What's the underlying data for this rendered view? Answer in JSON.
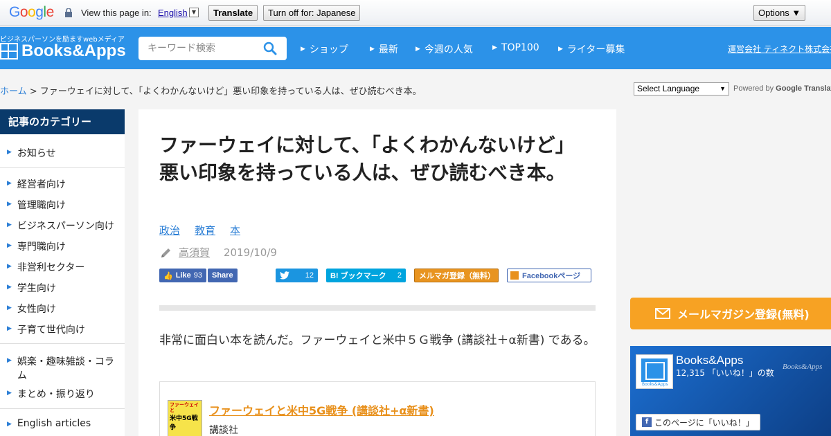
{
  "translate_bar": {
    "logo_letters": [
      "G",
      "o",
      "o",
      "g",
      "l",
      "e"
    ],
    "view_label": "View this page in:",
    "language": "English",
    "translate_button": "Translate",
    "turn_off_button": "Turn off for: Japanese",
    "options_button": "Options ▼"
  },
  "header": {
    "tagline": "ビジネスパーソンを励ますwebメディア",
    "logo_text": "Books&Apps",
    "search_placeholder": "キーワード検索",
    "nav": [
      "ショップ",
      "最新",
      "今週の人気",
      "TOP100",
      "ライター募集"
    ],
    "corp_link": "運営会社 ティネクト株式会社"
  },
  "breadcrumb": {
    "home": "ホーム",
    "separator": " > ",
    "current": "ファーウェイに対して、「よくわかんないけど」悪い印象を持っている人は、ぜひ読むべき本。"
  },
  "language_widget": {
    "select_label": "Select Language",
    "powered_by": "Powered by",
    "google": "Google",
    "translate": "Translate"
  },
  "sidebar": {
    "title": "記事のカテゴリー",
    "items": [
      "お知らせ",
      "経営者向け",
      "管理職向け",
      "ビジネスパーソン向け",
      "専門職向け",
      "非営利セクター",
      "学生向け",
      "女性向け",
      "子育て世代向け",
      "娯楽・趣味雑談・コラム",
      "まとめ・振り返り",
      "English articles"
    ]
  },
  "article": {
    "title": "ファーウェイに対して、「よくわかんないけど」悪い印象を持っている人は、ぜひ読むべき本。",
    "tags": [
      "政治",
      "教育",
      "本"
    ],
    "author": "高須賀",
    "date": "2019/10/9",
    "share": {
      "like_label": "Like",
      "like_count": "93",
      "share_label": "Share",
      "tweet_count": "12",
      "hatena_label": "B! ブックマーク",
      "hatena_count": "2",
      "mail_label": "メルマガ登録（無料）",
      "fbpage_label": "Facebookページ"
    },
    "body": "非常に面白い本を読んだ。ファーウェイと米中５Ｇ戦争 (講談社＋α新書) である。",
    "book": {
      "cover_top": "ファーウェイと",
      "cover_main": "米中5G戦争",
      "title": "ファーウェイと米中5G戦争 (講談社+α新書)",
      "publisher": "講談社"
    }
  },
  "right": {
    "mailmag_button": "メールマガジン登録(無料)",
    "fb_widget": {
      "name": "Books&Apps",
      "count": "12,315 「いいね！」の数",
      "brand": "Books&Apps",
      "like_button": "このページに「いいね！」",
      "logo_caption": "Books&Apps"
    }
  },
  "colors": {
    "header_blue": "#2c92e8",
    "sidebar_navy": "#0a3a6b",
    "link_blue": "#2c7fd6",
    "orange": "#f7a223"
  }
}
